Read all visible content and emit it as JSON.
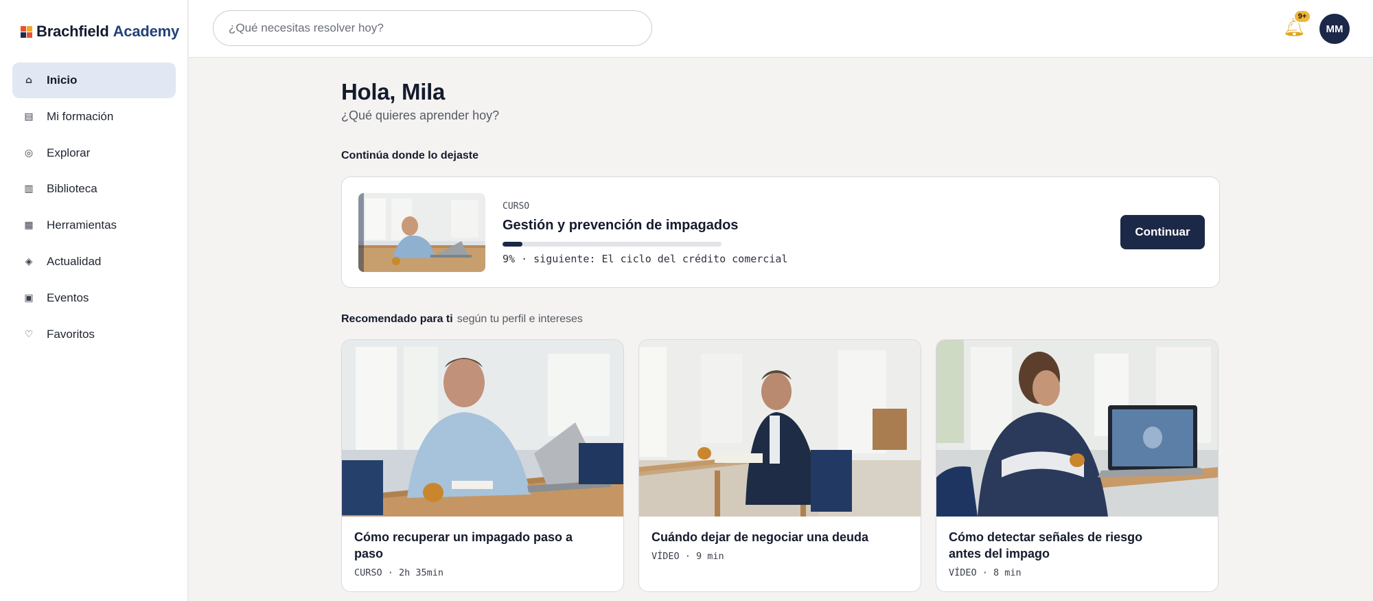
{
  "app": {
    "brand_part1": "Brachfield",
    "brand_part2": "Academy"
  },
  "colors": {
    "primary": "#1b2847",
    "brand_accent": "#24417a",
    "active_nav_bg": "#e1e8f3",
    "badge": "#f0b63a"
  },
  "search": {
    "placeholder": "¿Qué necesitas resolver hoy?"
  },
  "header": {
    "notifications_badge": "9+",
    "notifications_icon": "bell-icon",
    "avatar_initials": "MM"
  },
  "sidebar": {
    "items": [
      {
        "label": "Inicio",
        "icon": "home-icon",
        "glyph": "⌂",
        "active": true
      },
      {
        "label": "Mi formación",
        "icon": "training-icon",
        "glyph": "▤",
        "active": false
      },
      {
        "label": "Explorar",
        "icon": "compass-icon",
        "glyph": "◎",
        "active": false
      },
      {
        "label": "Biblioteca",
        "icon": "library-icon",
        "glyph": "▥",
        "active": false
      },
      {
        "label": "Herramientas",
        "icon": "tools-icon",
        "glyph": "▦",
        "active": false
      },
      {
        "label": "Actualidad",
        "icon": "news-icon",
        "glyph": "◈",
        "active": false
      },
      {
        "label": "Eventos",
        "icon": "calendar-icon",
        "glyph": "▣",
        "active": false
      },
      {
        "label": "Favoritos",
        "icon": "heart-icon",
        "glyph": "♡",
        "active": false
      }
    ]
  },
  "main": {
    "greeting": "Hola, Mila",
    "subgreeting": "¿Qué quieres aprender hoy?",
    "continue_section_title": "Continúa donde lo dejaste",
    "continue_card": {
      "kicker": "CURSO",
      "title": "Gestión y prevención de impagados",
      "progress_percent": 9,
      "meta": "9% · siguiente: El ciclo del crédito comercial",
      "button_label": "Continuar"
    },
    "recommended_title": "Recomendado para ti",
    "recommended_sub": "según tu perfil e intereses",
    "cards": [
      {
        "title": "Cómo recuperar un impagado paso a paso",
        "meta": "CURSO · 2h 35min"
      },
      {
        "title": "Cuándo dejar de negociar una deuda",
        "meta": "VÍDEO · 9 min"
      },
      {
        "title": "Cómo detectar señales de riesgo antes del impago",
        "meta": "VÍDEO · 8 min"
      }
    ]
  }
}
